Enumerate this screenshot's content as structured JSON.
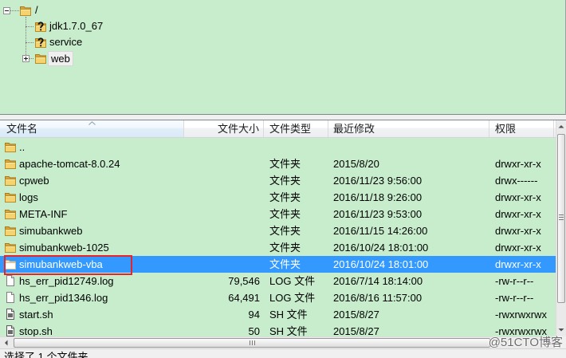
{
  "tree": {
    "root": {
      "label": "/",
      "icon": "folder-icon",
      "expanded": true
    },
    "children": [
      {
        "label": "jdk1.7.0_67",
        "icon": "unknown-folder-icon"
      },
      {
        "label": "service",
        "icon": "unknown-folder-icon"
      },
      {
        "label": "web",
        "icon": "folder-icon",
        "expanded": false,
        "selected": true
      }
    ]
  },
  "file_list": {
    "columns": {
      "name": "文件名",
      "size": "文件大小",
      "type": "文件类型",
      "modified": "最近修改",
      "permissions": "权限"
    },
    "sort": {
      "column_index": 0,
      "icon": "sort-ascending-icon"
    },
    "rows": [
      {
        "name": "..",
        "icon": "folder-icon"
      },
      {
        "name": "apache-tomcat-8.0.24",
        "type": "文件夹",
        "modified": "2015/8/20",
        "permissions": "drwxr-xr-x",
        "icon": "folder-icon"
      },
      {
        "name": "cpweb",
        "type": "文件夹",
        "modified": "2016/11/23 9:56:00",
        "permissions": "drwx------",
        "icon": "folder-icon"
      },
      {
        "name": "logs",
        "type": "文件夹",
        "modified": "2016/11/18 9:26:00",
        "permissions": "drwxr-xr-x",
        "icon": "folder-icon"
      },
      {
        "name": "META-INF",
        "type": "文件夹",
        "modified": "2016/11/23 9:53:00",
        "permissions": "drwxr-xr-x",
        "icon": "folder-icon"
      },
      {
        "name": "simubankweb",
        "type": "文件夹",
        "modified": "2016/11/15 14:26:00",
        "permissions": "drwxr-xr-x",
        "icon": "folder-icon"
      },
      {
        "name": "simubankweb-1025",
        "type": "文件夹",
        "modified": "2016/10/24 18:01:00",
        "permissions": "drwxr-xr-x",
        "icon": "folder-icon"
      },
      {
        "name": "simubankweb-vba",
        "type": "文件夹",
        "modified": "2016/10/24 18:01:00",
        "permissions": "drwxr-xr-x",
        "icon": "folder-icon",
        "selected": true,
        "annotated": true
      },
      {
        "name": "hs_err_pid12749.log",
        "size": "79,546",
        "type": "LOG 文件",
        "modified": "2016/7/14 18:14:00",
        "permissions": "-rw-r--r--",
        "icon": "log-file-icon"
      },
      {
        "name": "hs_err_pid1346.log",
        "size": "64,491",
        "type": "LOG 文件",
        "modified": "2016/8/16 11:57:00",
        "permissions": "-rw-r--r--",
        "icon": "log-file-icon"
      },
      {
        "name": "start.sh",
        "size": "94",
        "type": "SH 文件",
        "modified": "2015/8/27",
        "permissions": "-rwxrwxrwx",
        "icon": "shell-script-icon"
      },
      {
        "name": "stop.sh",
        "size": "50",
        "type": "SH 文件",
        "modified": "2015/8/27",
        "permissions": "-rwxrwxrwx",
        "icon": "shell-script-icon"
      }
    ]
  },
  "status_bar": {
    "text": "选择了 1 个文件夹"
  },
  "watermark": "@51CTO博客",
  "colors": {
    "panel_background": "#c7edcc",
    "selection": "#3399ff",
    "annotation_box": "#e3262b"
  }
}
